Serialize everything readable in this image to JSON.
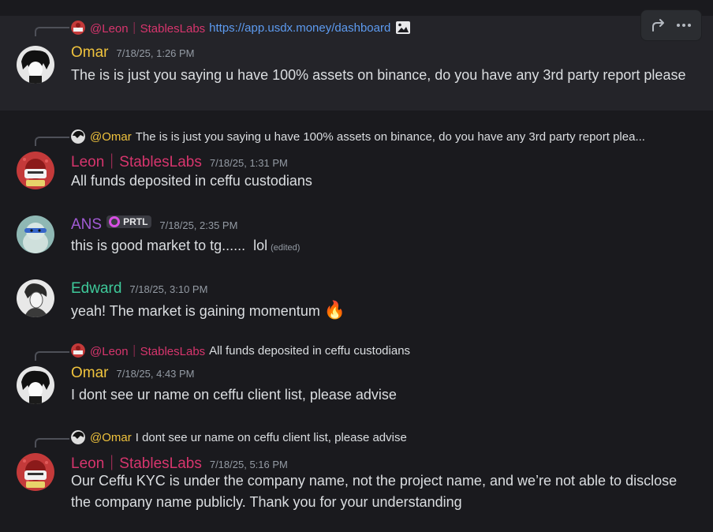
{
  "toolbar": {
    "forward_icon": "forward-arrow-icon",
    "more_icon": "more-dots-icon"
  },
  "messages": [
    {
      "reply": {
        "name": "@Leon｜StablesLabs",
        "link": "https://app.usdx.money/dashboard",
        "extra_icon": "image-icon"
      },
      "author": "Omar",
      "time": "7/18/25, 1:26 PM",
      "text": "The is is just you saying u have 100% assets on binance, do you have any 3rd party report please"
    },
    {
      "reply": {
        "name": "@Omar",
        "text": "The is is just you saying u have 100% assets on binance, do you have any 3rd party report plea..."
      },
      "author": "Leon｜StablesLabs",
      "time": "7/18/25, 1:31 PM",
      "text": "All funds deposited in ceffu custodians"
    },
    {
      "author": "ANS",
      "tag": "PRTL",
      "time": "7/18/25, 2:35 PM",
      "text": "this is good market to tg......  lol",
      "edited": "(edited)"
    },
    {
      "author": "Edward",
      "time": "7/18/25, 3:10 PM",
      "text": "yeah! The market is gaining momentum",
      "emoji": "🔥"
    },
    {
      "reply": {
        "name": "@Leon｜StablesLabs",
        "text": "All funds deposited in ceffu custodians"
      },
      "author": "Omar",
      "time": "7/18/25, 4:43 PM",
      "text": "I dont see ur name on ceffu client list, please advise"
    },
    {
      "reply": {
        "name": "@Omar",
        "text": "I dont see ur name on ceffu client list, please advise"
      },
      "author": "Leon｜StablesLabs",
      "time": "7/18/25, 5:16 PM",
      "text": "Our Ceffu KYC is under the company name, not the project name, and we’re not able to disclose the company name publicly. Thank you for your understanding"
    }
  ],
  "colors": {
    "omar": "#f0c33d",
    "leon": "#d7356d",
    "ans": "#a25bd6",
    "edward": "#3ec99a",
    "link": "#5d9bf0",
    "background": "#1a1a1e",
    "hover": "#242429"
  }
}
